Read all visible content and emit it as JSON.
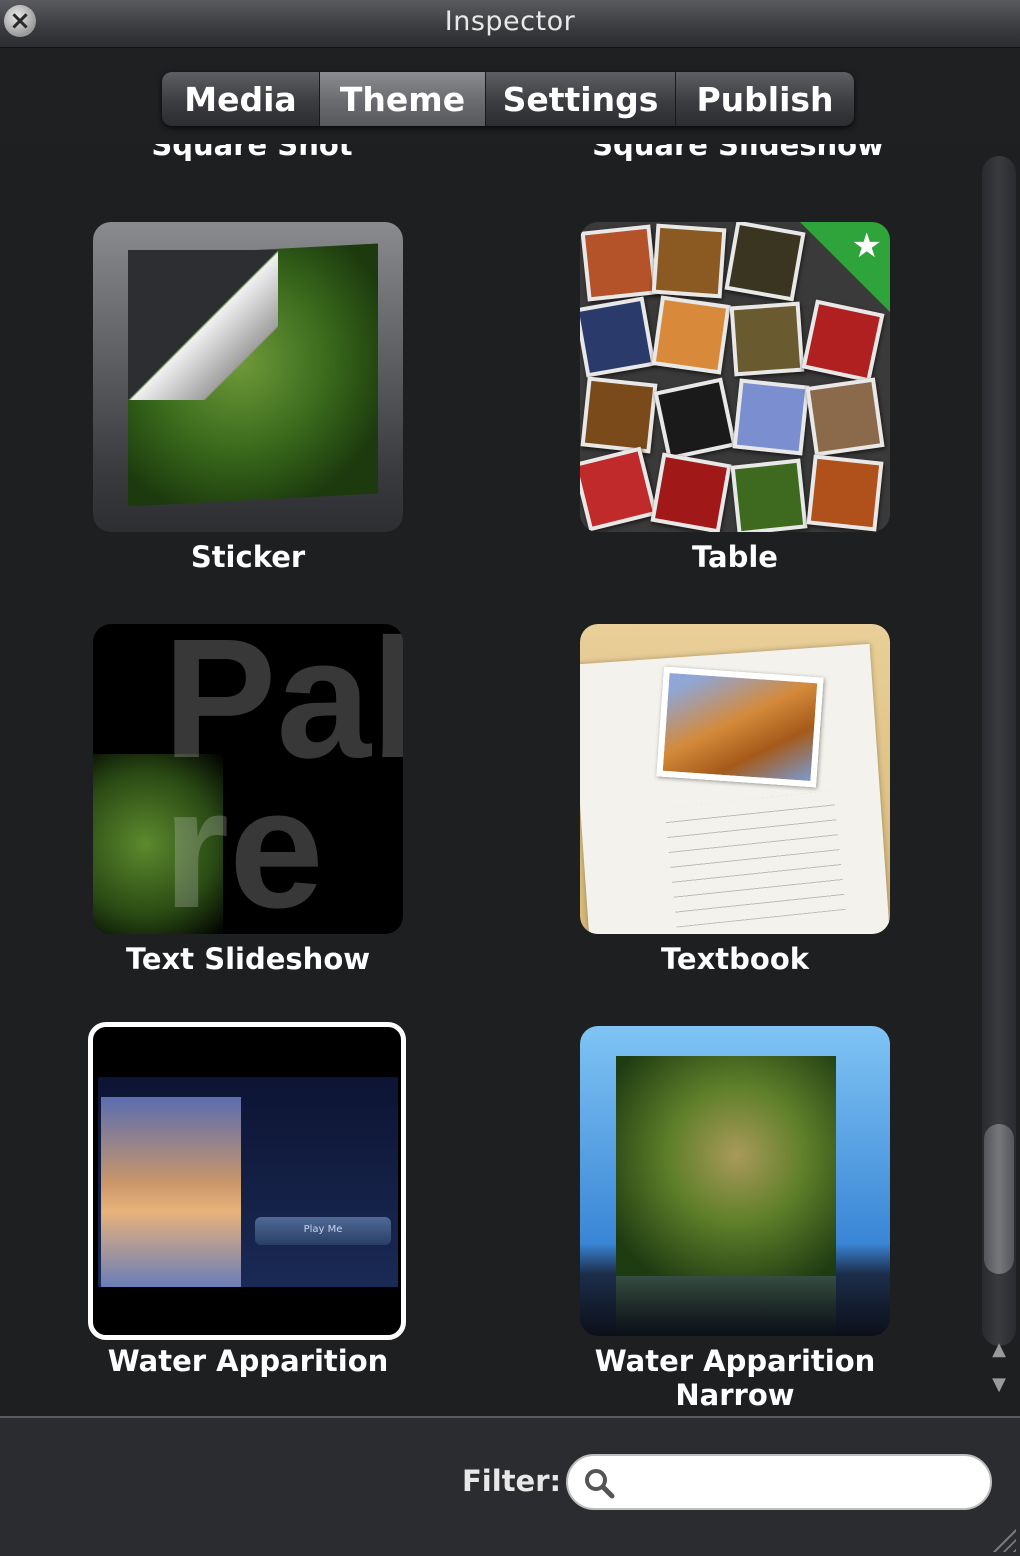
{
  "window": {
    "title": "Inspector",
    "close_icon": "close-icon"
  },
  "tabs": [
    {
      "label": "Media",
      "active": false
    },
    {
      "label": "Theme",
      "active": true
    },
    {
      "label": "Settings",
      "active": false
    },
    {
      "label": "Publish",
      "active": false
    }
  ],
  "cutoff_labels": [
    "Square Shot",
    "Square Slideshow"
  ],
  "themes": [
    {
      "label": "Sticker",
      "selected": false
    },
    {
      "label": "Table",
      "selected": false,
      "badge": "star-icon"
    },
    {
      "label": "Text Slideshow",
      "selected": false
    },
    {
      "label": "Textbook",
      "selected": false
    },
    {
      "label": "Water Apparition",
      "selected": true
    },
    {
      "label": "Water Apparition Narrow",
      "selected": false
    }
  ],
  "water_apparition_button": "Play Me",
  "filter": {
    "label": "Filter:",
    "value": "",
    "placeholder": "",
    "icon": "search-icon"
  },
  "colors": {
    "background": "#1e1f21",
    "badge_green": "#2ea43a",
    "selection_border": "#ffffff"
  }
}
